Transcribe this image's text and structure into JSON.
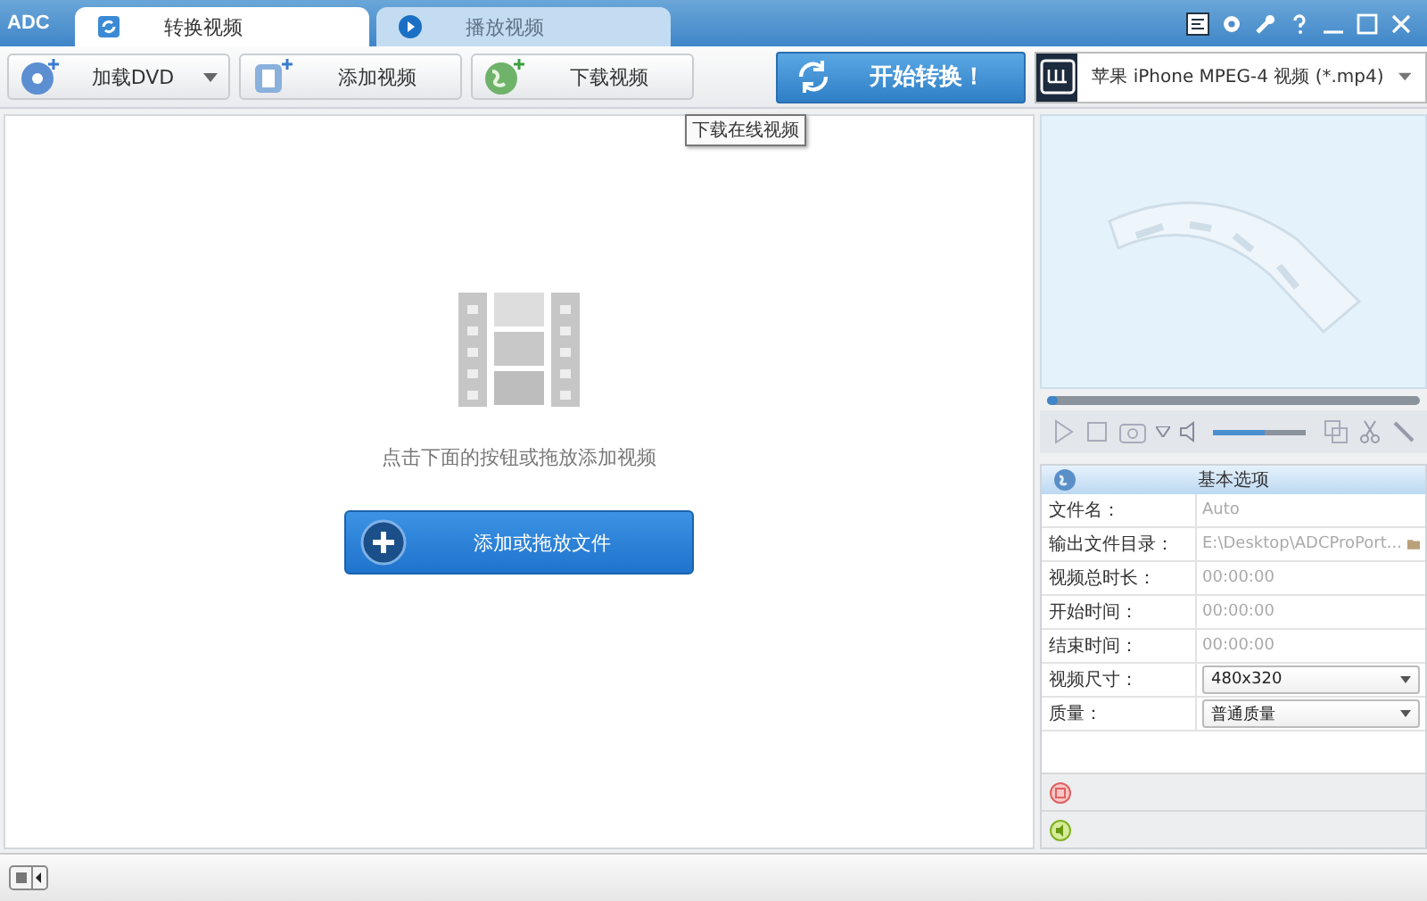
{
  "window": {
    "logo": "ADC",
    "tabs": [
      {
        "label": "转换视频",
        "selected": true
      },
      {
        "label": "播放视频",
        "selected": false
      }
    ]
  },
  "toolbar": {
    "buttons": [
      {
        "label": "加载DVD",
        "kind": "dropdown"
      },
      {
        "label": "添加视频",
        "kind": "plain"
      },
      {
        "label": "下载视频",
        "kind": "plain"
      }
    ],
    "start_button": "开始转换！",
    "format": "苹果 iPhone MPEG-4 视频 (*.mp4)"
  },
  "tooltip": "下载在线视频",
  "drop_area": {
    "hint": "点击下面的按钮或拖放添加视频",
    "button": "添加或拖放文件"
  },
  "player": {
    "seek": {
      "level": 0
    },
    "volume": {
      "level": 0.55
    }
  },
  "options": {
    "title": "基本选项",
    "rows": [
      {
        "label": "文件名：",
        "value": "Auto",
        "kind": "text"
      },
      {
        "label": "输出文件目录：",
        "value": "E:\\Desktop\\ADCProPort...",
        "kind": "folder"
      },
      {
        "label": "视频总时长：",
        "value": "00:00:00",
        "kind": "text"
      },
      {
        "label": "开始时间：",
        "value": "00:00:00",
        "kind": "text"
      },
      {
        "label": "结束时间：",
        "value": "00:00:00",
        "kind": "text"
      },
      {
        "label": "视频尺寸：",
        "value": "480x320",
        "kind": "select"
      },
      {
        "label": "质量：",
        "value": "普通质量",
        "kind": "select"
      }
    ]
  }
}
